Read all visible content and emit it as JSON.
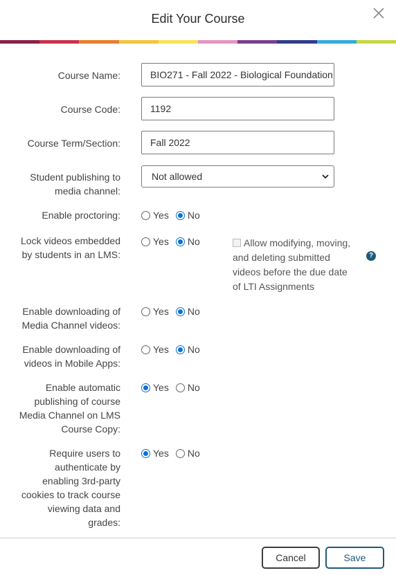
{
  "dialog": {
    "title": "Edit Your Course"
  },
  "stripe_colors": [
    "#8a2144",
    "#c9334b",
    "#e97d2f",
    "#f5c340",
    "#f6e35a",
    "#e495c1",
    "#7a3f8f",
    "#2f3d8c",
    "#37a9dd",
    "#c6d844"
  ],
  "fields": {
    "course_name": {
      "label": "Course Name:",
      "value": "BIO271 - Fall 2022 - Biological Foundation"
    },
    "course_code": {
      "label": "Course Code:",
      "value": "1192"
    },
    "course_term": {
      "label": "Course Term/Section:",
      "value": "Fall 2022"
    },
    "student_publishing": {
      "label_line1": "Student publishing to",
      "label_line2": "media channel:",
      "selected": "Not allowed"
    }
  },
  "options": {
    "yes": "Yes",
    "no": "No"
  },
  "toggles": {
    "proctoring": {
      "label": "Enable proctoring:",
      "selected": "No"
    },
    "lock_videos": {
      "label_line1": "Lock videos embedded",
      "label_line2": "by students in an LMS:",
      "selected": "No"
    },
    "download_channel": {
      "label_line1": "Enable downloading of",
      "label_line2": "Media Channel videos:",
      "selected": "No"
    },
    "download_mobile": {
      "label_line1": "Enable downloading of",
      "label_line2": "videos in Mobile Apps:",
      "selected": "No"
    },
    "auto_publish": {
      "label_lines": [
        "Enable automatic",
        "publishing of course",
        "Media Channel on LMS",
        "Course Copy:"
      ],
      "selected": "Yes"
    },
    "third_party_cookies": {
      "label_lines": [
        "Require users to",
        "authenticate by",
        "enabling 3rd-party",
        "cookies to track course",
        "viewing data and",
        "grades:"
      ],
      "selected": "Yes"
    }
  },
  "lti_checkbox": {
    "lines": [
      "Allow modifying, moving,",
      "and deleting submitted",
      "videos before the due date",
      "of LTI Assignments"
    ],
    "checked": false
  },
  "buttons": {
    "cancel": "Cancel",
    "save": "Save"
  }
}
